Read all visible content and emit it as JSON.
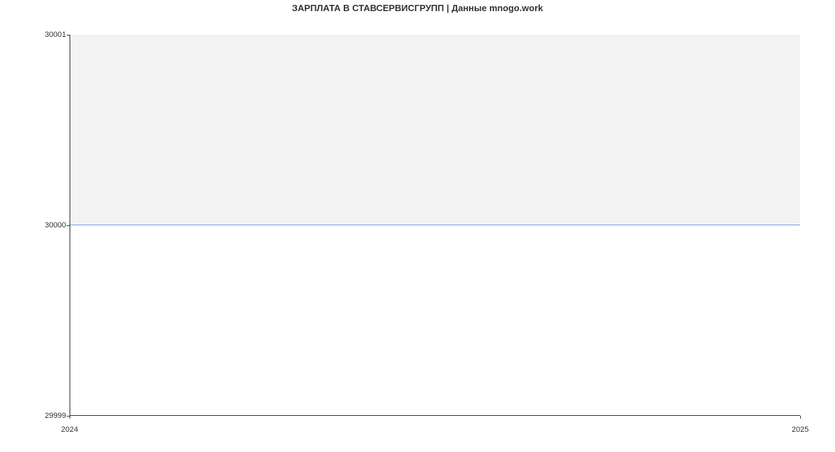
{
  "chart_data": {
    "type": "line",
    "title": "ЗАРПЛАТА В СТАВСЕРВИСГРУПП | Данные mnogo.work",
    "xlabel": "",
    "ylabel": "",
    "x_labels": [
      "2024",
      "2025"
    ],
    "x_values": [
      2024,
      2025
    ],
    "y_values": [
      30000,
      30000
    ],
    "ylim": [
      29999,
      30001
    ],
    "y_ticks": [
      29999,
      30000,
      30001
    ],
    "xlim": [
      2024,
      2025
    ],
    "series_color": "#6c9ee8",
    "area_fill_color": "#f3f3f3"
  }
}
